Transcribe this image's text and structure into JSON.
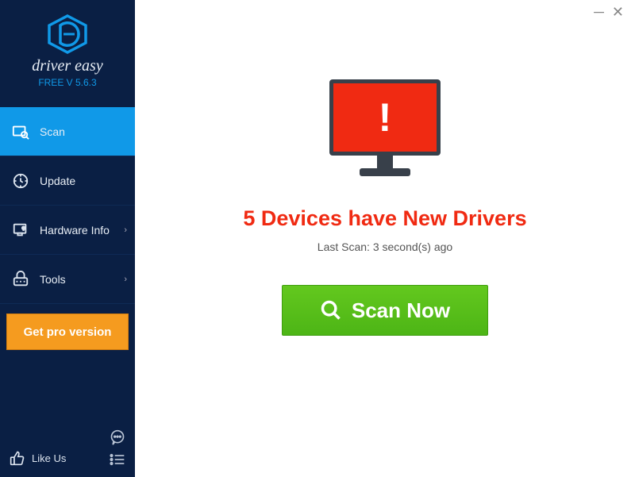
{
  "app": {
    "name": "driver easy",
    "version": "FREE V 5.6.3"
  },
  "sidebar": {
    "items": [
      {
        "label": "Scan",
        "icon": "scan-icon",
        "active": true,
        "expandable": false
      },
      {
        "label": "Update",
        "icon": "update-icon",
        "active": false,
        "expandable": false
      },
      {
        "label": "Hardware Info",
        "icon": "hardware-info-icon",
        "active": false,
        "expandable": true
      },
      {
        "label": "Tools",
        "icon": "tools-icon",
        "active": false,
        "expandable": true
      }
    ],
    "get_pro_label": "Get pro version",
    "like_us_label": "Like Us"
  },
  "main": {
    "headline": "5 Devices have New Drivers",
    "new_driver_count": 5,
    "last_scan_label": "Last Scan: 3 second(s) ago",
    "scan_button_label": "Scan Now",
    "alert_symbol": "!"
  },
  "colors": {
    "sidebar_bg": "#0a1f44",
    "accent": "#1099e8",
    "pro_button": "#f59b1f",
    "scan_button": "#4db516",
    "alert_red": "#f02a12"
  }
}
